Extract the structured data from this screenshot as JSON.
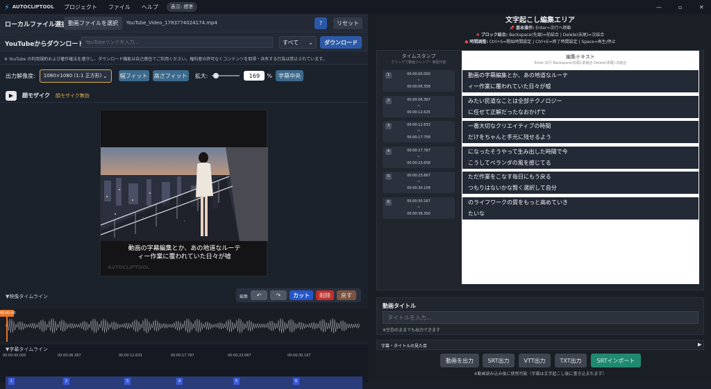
{
  "titlebar": {
    "app": "AUTOCLIPTOOL",
    "menus": [
      "プロジェクト",
      "ファイル",
      "ヘルプ"
    ],
    "display_badge": "表示: 標準"
  },
  "left": {
    "local": {
      "title": "ローカルファイル選択",
      "select_btn": "動画ファイルを選択",
      "filename": "YouTube_Video_1783774024174.mp4",
      "help": "?",
      "reset": "リセット"
    },
    "youtube": {
      "title": "YouTubeからダウンロード",
      "placeholder": "YouTubeリンクを入力...",
      "quality": "すべて",
      "download": "ダウンロード",
      "notice": "※ YouTube の利用規約および著作権法を遵守し、ダウンロード機能は自己責任でご利用ください。権利者の許可なくコンテンツを取得・共有する行為は禁止されています。"
    },
    "output": {
      "label": "出力解像度:",
      "resolution": "1080×1080 (1:1 正方形)",
      "fit_width": "幅フィット",
      "fit_height": "高さフィット",
      "zoom_label": "拡大:",
      "zoom_value": "169",
      "zoom_unit": "%",
      "center_sub": "字幕中央",
      "zoom_level": 0.06
    },
    "mosaic": {
      "title": "顔モザイク",
      "status": "顔モザイク無効"
    },
    "preview": {
      "caption_line1": "動画の字幕編集とか、あの地道なルーテ",
      "caption_line2": "ィー作業に覆われていた日々が嘘",
      "watermark": "AUTOCLIPTOOL"
    },
    "video_timeline": {
      "title": "▼映像タイムライン",
      "edit_label": "編集",
      "undo": "↶",
      "redo": "↷",
      "cut": "カット",
      "delete": "削除",
      "restore": "戻す",
      "playhead": "00:00:00"
    },
    "sub_timeline": {
      "title": "▼字幕タイムライン",
      "ticks": [
        "00:00:00.000",
        "00:00:06.367",
        "00:00:12.633",
        "00:00:17.767",
        "00:00:23.667",
        "00:00:30.167"
      ],
      "markers": [
        "1",
        "2",
        "3",
        "4",
        "5",
        "6"
      ]
    }
  },
  "right": {
    "title": "文字起こし編集エリア",
    "help": [
      {
        "icon": "📌",
        "bold": "基本操作:",
        "text": "Enter=次行へ移動"
      },
      {
        "icon": "✖",
        "bold": "ブロック結合:",
        "text": "Backspace(先頭)=前結合 | Delete(末尾)=次結合"
      },
      {
        "icon": "●",
        "bold": "時間調整:",
        "text": "Ctrl+S=開始時間設定 | Ctrl+E=終了時間設定 | Space=再生/停止"
      }
    ],
    "ts_header": "タイムスタンプ",
    "ts_sub": "クリックで動画ジャンプ・範囲可能",
    "edit_header": "編集テキスト",
    "edit_sub": "Enter:次行 Backspace(先頭):前結合 Delete(末尾):次結合",
    "rows": [
      {
        "n": "1",
        "start": "00:00:00.000",
        "sep": "~",
        "end": "00:00:06.358",
        "l1": "動画の字幕編集とか、あの地道なルーテ",
        "l2": "ィー作業に覆われていた日々が嘘"
      },
      {
        "n": "2",
        "start": "00:00:06.367",
        "sep": "~",
        "end": "00:00:12.625",
        "l1": "みたい民道なことは全部テクノロジー",
        "l2": "に任せて正解だったなおかげで"
      },
      {
        "n": "3",
        "start": "00:00:12.633",
        "sep": "~",
        "end": "00:00:17.758",
        "l1": "一番大切なクリエイティブの時間",
        "l2": "だけをちゃんと手元に残せるよう"
      },
      {
        "n": "4",
        "start": "00:00:17.767",
        "sep": "~",
        "end": "00:00:23.658",
        "l1": "になったそうやって生み出した時間で今",
        "l2": "こうしてベランダの風を感じてる"
      },
      {
        "n": "5",
        "start": "00:00:23.667",
        "sep": "~",
        "end": "00:00:30.158",
        "l1": "ただ作業をこなす毎日にもう戻る",
        "l2": "つもりはないかな賢く選択して自分"
      },
      {
        "n": "6",
        "start": "00:00:30.167",
        "sep": "~",
        "end": "00:00:36.300",
        "l1": "のライフワークの質をもっと高めていき",
        "l2": "たいな"
      }
    ],
    "video_title": {
      "label": "動画タイトル",
      "placeholder": "タイトルを入力...",
      "note": "※空白のままでも出力できます"
    },
    "caption_section": "字幕・タイトルの見た目",
    "export": [
      "動画を出力",
      "SRT出力",
      "VTT出力",
      "TXT出力",
      "SRTインポート"
    ],
    "export_note": "※動画読み込み後に使用可能（字幕は文字起こし後に書き込まれます）"
  }
}
